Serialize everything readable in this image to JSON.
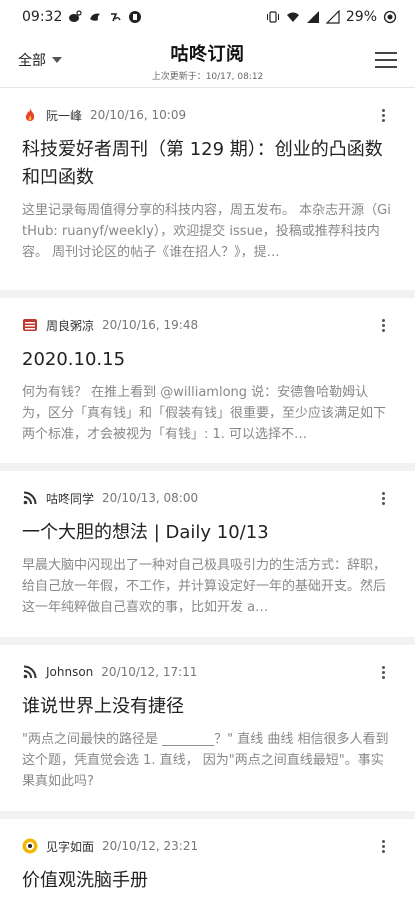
{
  "status_bar": {
    "time": "09:32",
    "battery": "29%"
  },
  "app_bar": {
    "filter_label": "全部",
    "title": "咕咚订阅",
    "subtitle": "上次更新于：10/17, 08:12"
  },
  "feed": {
    "items": [
      {
        "author": "阮一峰",
        "date": "20/10/16, 10:09",
        "title": "科技爱好者周刊（第 129 期）：创业的凸函数和凹函数",
        "summary": "这里记录每周值得分享的科技内容，周五发布。 本杂志开源（GitHub: ruanyf/weekly），欢迎提交 issue，投稿或推荐科技内容。 周刊讨论区的帖子《谁在招人？》，提…",
        "icon": "fire-icon",
        "icon_color": "#e8452c"
      },
      {
        "author": "周良粥凉",
        "date": "20/10/16, 19:48",
        "title": "2020.10.15",
        "summary": "何为有钱？ 在推上看到 @williamlong 说：安德鲁哈勒姆认为，区分「真有钱」和「假装有钱」很重要，至少应该满足如下两个标准，才会被视为「有钱」: 1. 可以选择不…",
        "icon": "book-icon",
        "icon_color": "#c0392b"
      },
      {
        "author": "咕咚同学",
        "date": "20/10/13, 08:00",
        "title": "一个大胆的想法 | Daily 10/13",
        "summary": "早晨大脑中闪现出了一种对自己极具吸引力的生活方式：辞职，给自己放一年假，不工作，并计算设定好一年的基础开支。然后这一年纯粹做自己喜欢的事，比如开发 a…",
        "icon": "rss-icon",
        "icon_color": "#333333"
      },
      {
        "author": "Johnson",
        "date": "20/10/12, 17:11",
        "title": "谁说世界上没有捷径",
        "summary": "\"两点之间最快的路径是 ________？\" 直线 曲线 相信很多人看到这个题，凭直觉会选 1. 直线， 因为\"两点之间直线最短\"。事实果真如此吗?",
        "icon": "rss-icon",
        "icon_color": "#333333"
      },
      {
        "author": "见字如面",
        "date": "20/10/12, 23:21",
        "title": "价值观洗脑手册",
        "summary": "",
        "icon": "avatar-icon",
        "icon_color": "#f2b705"
      }
    ]
  }
}
